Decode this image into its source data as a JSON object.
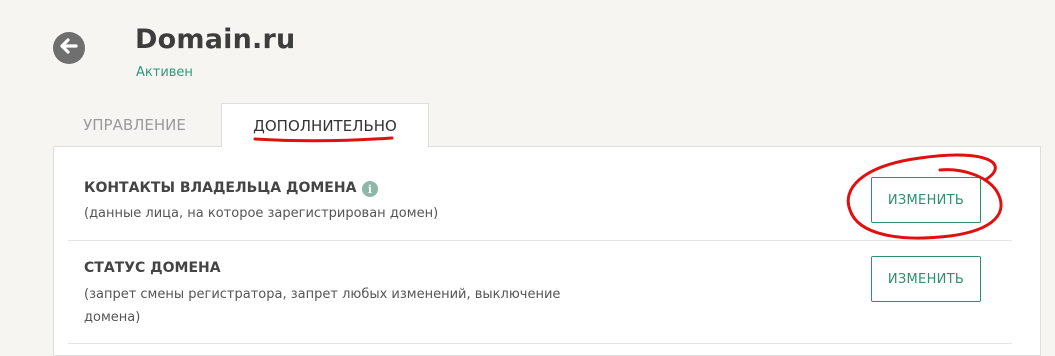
{
  "header": {
    "back_icon": "arrow-left-icon",
    "title": "Domain.ru",
    "status": "Активен"
  },
  "tabs": [
    {
      "label": "УПРАВЛЕНИЕ",
      "active": false
    },
    {
      "label": "ДОПОЛНИТЕЛЬНО",
      "active": true
    }
  ],
  "sections": [
    {
      "title": "КОНТАКТЫ ВЛАДЕЛЬЦА ДОМЕНА",
      "info_icon": "info-icon",
      "description": "(данные лица, на которое зарегистрирован домен)",
      "button_label": "ИЗМЕНИТЬ"
    },
    {
      "title": "СТАТУС ДОМЕНА",
      "description_line1": "(запрет смены регистратора, запрет любых изменений, выключение",
      "description_line2": "домена)",
      "button_label": "ИЗМЕНИТЬ"
    }
  ],
  "colors": {
    "accent": "#2f8f6f",
    "annotation": "#e01010",
    "background": "#f6f5f2"
  }
}
